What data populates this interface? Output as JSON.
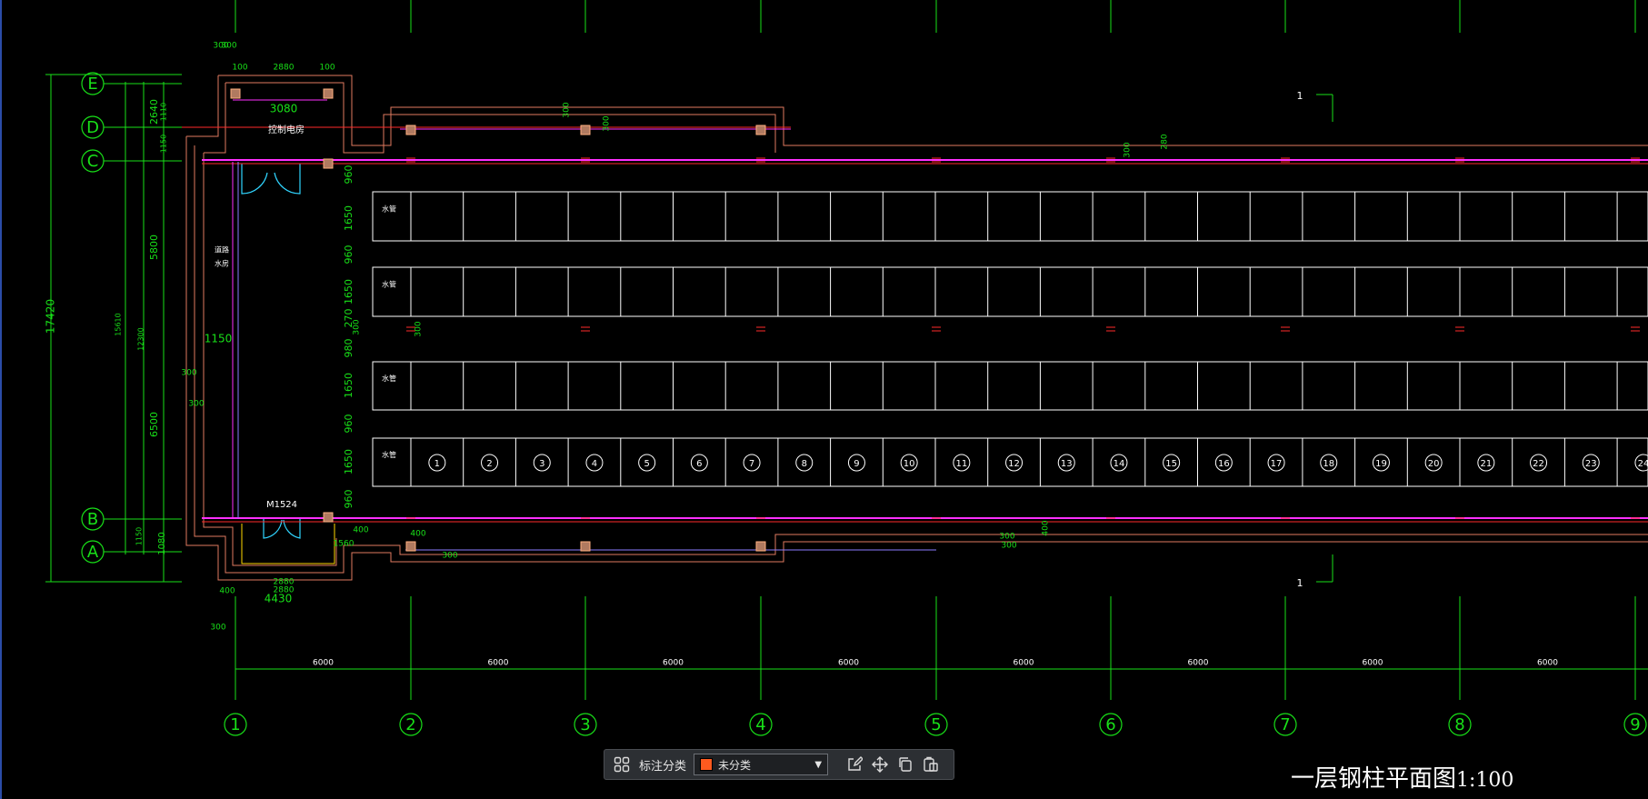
{
  "toolbar": {
    "label": "标注分类",
    "category_value": "未分类",
    "category_color": "#ff5a1f",
    "icons": [
      "grid-icon",
      "edit-icon",
      "move-icon",
      "copy-icon",
      "paste-icon"
    ]
  },
  "drawing": {
    "title": "一层钢柱平面图",
    "scale": "1:100",
    "col_axes": [
      "1",
      "2",
      "3",
      "4",
      "5",
      "6",
      "7",
      "8",
      "9"
    ],
    "row_axes": [
      "E",
      "D",
      "C",
      "B",
      "A"
    ],
    "bay_dims": [
      "6000",
      "6000",
      "6000",
      "6000",
      "6000",
      "6000",
      "6000",
      "6000"
    ],
    "left_dims": [
      "2640",
      "5800",
      "6500",
      "1080",
      "1150",
      "1150",
      "15610",
      "12300",
      "17420",
      "1110"
    ],
    "vert_dims": [
      "960",
      "1650",
      "960",
      "1650",
      "270",
      "980",
      "1650",
      "960",
      "1650",
      "960"
    ],
    "misc_dims": [
      "300",
      "300",
      "100",
      "2880",
      "100",
      "3080",
      "2880",
      "1150",
      "300",
      "300",
      "400",
      "4430",
      "2880",
      "300",
      "400",
      "300",
      "400",
      "1560",
      "300",
      "300",
      "300",
      "280",
      "300",
      "300",
      "300",
      "400",
      "300"
    ],
    "room_control": "控制电房",
    "room_side": "道路\n水房",
    "door_label": "M1524",
    "section_mark": "1",
    "row_label": "水管",
    "parking_numbers": [
      "1",
      "2",
      "3",
      "4",
      "5",
      "6",
      "7",
      "8",
      "9",
      "10",
      "11",
      "12",
      "13",
      "14",
      "15",
      "16",
      "17",
      "18",
      "19",
      "20",
      "21",
      "22",
      "23",
      "24"
    ]
  }
}
